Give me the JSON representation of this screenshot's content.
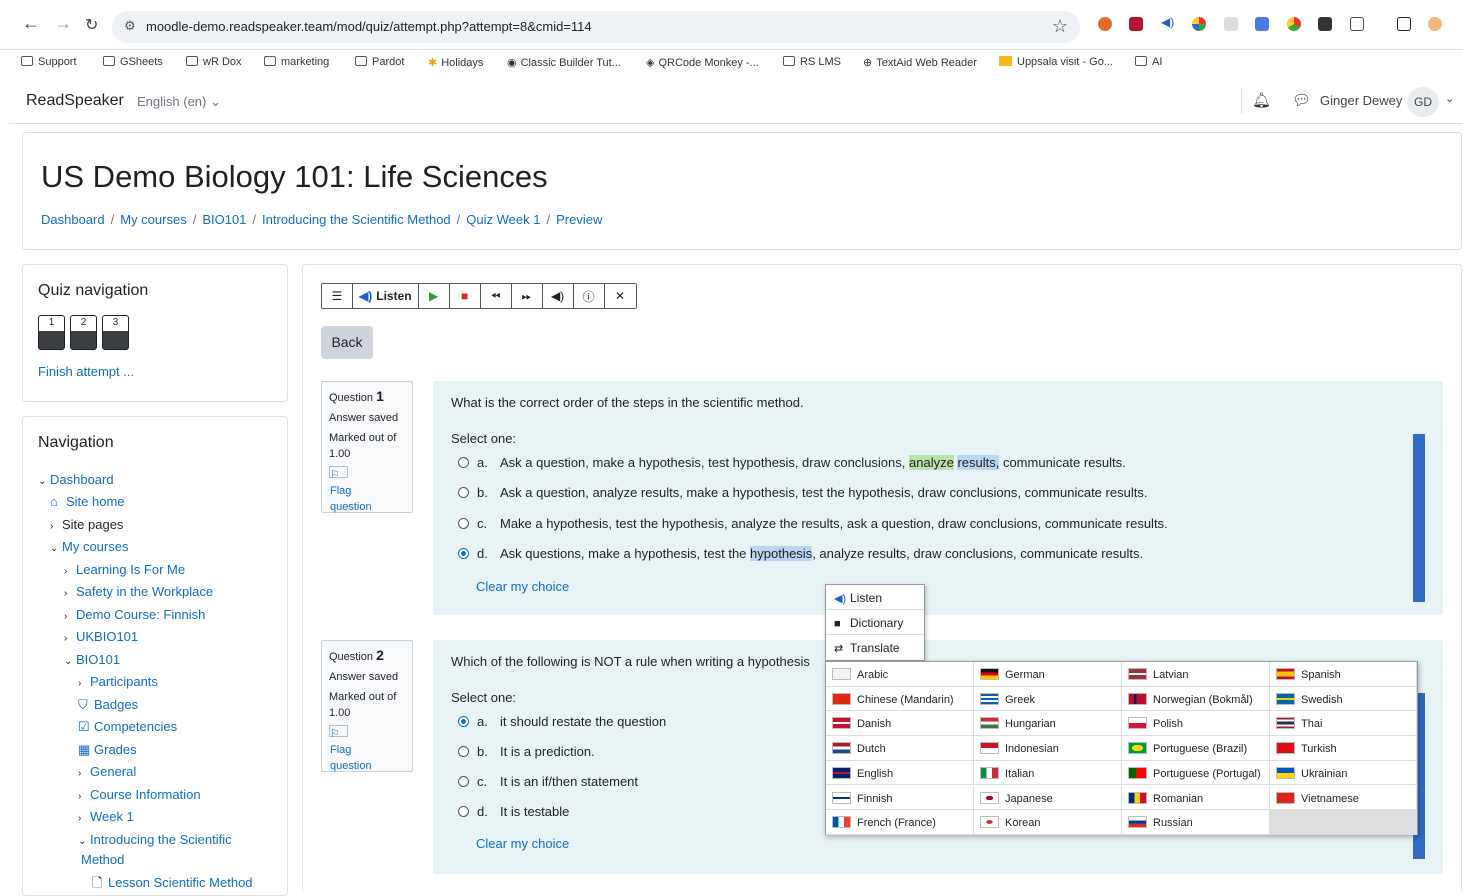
{
  "browser": {
    "url": "moodle-demo.readspeaker.team/mod/quiz/attempt.php?attempt=8&cmid=114",
    "bookmarks": [
      "Support",
      "GSheets",
      "wR Dox",
      "marketing",
      "Pardot",
      "Holidays",
      "Classic Builder Tut...",
      "QRCode Monkey -...",
      "RS LMS",
      "TextAid Web Reader",
      "Uppsala visit - Go...",
      "AI"
    ]
  },
  "topnav": {
    "brand": "ReadSpeaker",
    "language": "English (en) ⌄",
    "user": "Ginger Dewey",
    "initials": "GD"
  },
  "header": {
    "title": "US Demo Biology 101: Life Sciences",
    "breadcrumbs": [
      "Dashboard",
      "My courses",
      "BIO101",
      "Introducing the Scientific Method",
      "Quiz Week 1",
      "Preview"
    ]
  },
  "quiz_nav": {
    "title": "Quiz navigation",
    "buttons": [
      "1",
      "2",
      "3"
    ],
    "finish": "Finish attempt ..."
  },
  "navigation": {
    "title": "Navigation",
    "items": [
      {
        "label": "Dashboard",
        "chev": "⌄"
      },
      {
        "label": "Site home",
        "icon": "🏠"
      },
      {
        "label": "Site pages",
        "chev": "›"
      },
      {
        "label": "My courses",
        "chev": "⌄"
      },
      {
        "label": "Learning Is For Me",
        "chev": "›"
      },
      {
        "label": "Safety in the Workplace",
        "chev": "›"
      },
      {
        "label": "Demo Course: Finnish",
        "chev": "›"
      },
      {
        "label": "UKBIO101",
        "chev": "›"
      },
      {
        "label": "BIO101",
        "chev": "⌄"
      },
      {
        "label": "Participants",
        "chev": "›"
      },
      {
        "label": "Badges",
        "icon": "⛉"
      },
      {
        "label": "Competencies",
        "icon": "☑"
      },
      {
        "label": "Grades",
        "icon": "▦"
      },
      {
        "label": "General",
        "chev": "›"
      },
      {
        "label": "Course Information",
        "chev": "›"
      },
      {
        "label": "Week 1",
        "chev": "›"
      },
      {
        "label": "Introducing the Scientific",
        "chev": "⌄"
      },
      {
        "label": "Method"
      },
      {
        "label": "Lesson Scientific Method",
        "icon": "🗋"
      }
    ]
  },
  "toolbar": {
    "listen": "Listen"
  },
  "back_label": "Back",
  "questions": [
    {
      "number_label": "Question",
      "number": "1",
      "status": "Answer saved",
      "marked": "Marked out of",
      "points": "1.00",
      "flag": "Flag question",
      "text": "What is the correct order of the steps in the scientific method.",
      "select": "Select one:",
      "options": [
        {
          "letter": "a.",
          "parts": [
            "Ask a question, make a hypothesis, test hypothesis, draw conclusions, ",
            "analyze",
            " ",
            "results,",
            " communicate results."
          ]
        },
        {
          "letter": "b.",
          "text": "Ask a question, analyze results, make a hypothesis, test the hypothesis, draw conclusions, communicate results."
        },
        {
          "letter": "c.",
          "text": "Make a hypothesis, test the hypothesis, analyze the results, ask a question, draw conclusions, communicate results."
        },
        {
          "letter": "d.",
          "parts": [
            "Ask questions, make a hypothesis, test the ",
            "hypothesis",
            ", analyze results, draw conclusions, communicate results."
          ]
        }
      ],
      "selected": 3,
      "clear": "Clear my choice"
    },
    {
      "number_label": "Question",
      "number": "2",
      "status": "Answer saved",
      "marked": "Marked out of",
      "points": "1.00",
      "flag": "Flag question",
      "text": "Which of the following is NOT a rule when writing a hypothesis",
      "select": "Select one:",
      "options": [
        {
          "letter": "a.",
          "text": "it should restate the question"
        },
        {
          "letter": "b.",
          "text": "It is a prediction."
        },
        {
          "letter": "c.",
          "text": "It is an if/then statement"
        },
        {
          "letter": "d.",
          "text": "It is testable"
        }
      ],
      "selected": 0,
      "clear": "Clear my choice"
    }
  ],
  "popup_menu": [
    "Listen",
    "Dictionary",
    "Translate"
  ],
  "languages": [
    [
      "Arabic",
      "German",
      "Latvian",
      "Spanish"
    ],
    [
      "Chinese (Mandarin)",
      "Greek",
      "Norwegian (Bokmål)",
      "Swedish"
    ],
    [
      "Danish",
      "Hungarian",
      "Polish",
      "Thai"
    ],
    [
      "Dutch",
      "Indonesian",
      "Portuguese (Brazil)",
      "Turkish"
    ],
    [
      "English",
      "Italian",
      "Portuguese (Portugal)",
      "Ukrainian"
    ],
    [
      "Finnish",
      "Japanese",
      "Romanian",
      "Vietnamese"
    ],
    [
      "French (France)",
      "Korean",
      "Russian",
      ""
    ]
  ],
  "colors": {
    "link": "#0f6cbf",
    "question_bg": "#e7f3f5",
    "highlight_green": "#b7e4a9",
    "highlight_blue": "#b9d7f2",
    "scrollbar": "#2f6cc6"
  }
}
